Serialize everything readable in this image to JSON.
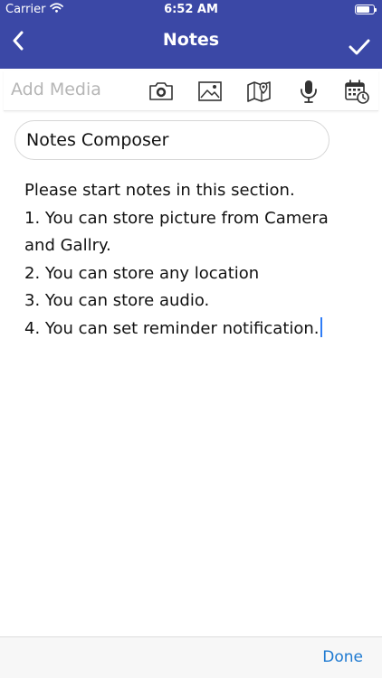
{
  "status_bar": {
    "carrier": "Carrier",
    "time": "6:52 AM"
  },
  "nav": {
    "title": "Notes"
  },
  "media_toolbar": {
    "label": "Add Media",
    "icons": [
      "camera-icon",
      "image-icon",
      "map-icon",
      "microphone-icon",
      "calendar-clock-icon"
    ]
  },
  "composer": {
    "title_value": "Notes Composer",
    "body_lines": [
      "Please start notes in this section.",
      "1. You can store picture from Camera",
      "and Gallry.",
      "2. You can store any location",
      "3. You can store audio.",
      "4. You can set reminder notification."
    ]
  },
  "keyboard_bar": {
    "done_label": "Done"
  },
  "colors": {
    "header": "#3b48a6",
    "accent": "#1e7ad1",
    "caret": "#2f7cf6"
  }
}
